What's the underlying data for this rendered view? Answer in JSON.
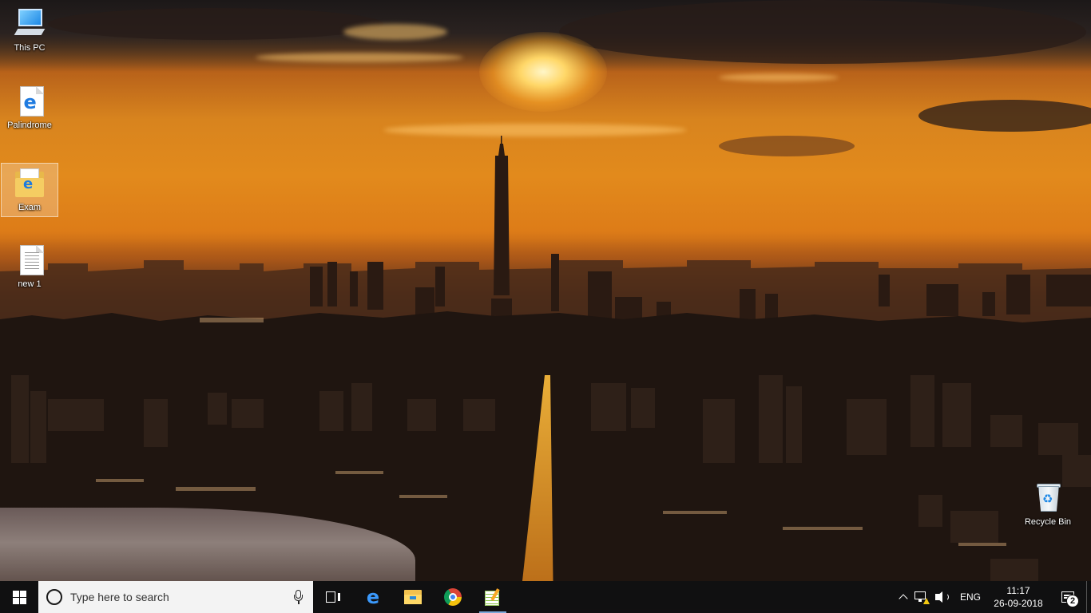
{
  "desktop": {
    "icons": [
      {
        "label": "This PC",
        "icon": "computer-icon"
      },
      {
        "label": "Palindrome",
        "icon": "edge-html-file-icon"
      },
      {
        "label": "Exam",
        "icon": "folder-icon"
      },
      {
        "label": "new 1",
        "icon": "text-file-icon"
      },
      {
        "label": "Recycle Bin",
        "icon": "recycle-bin-icon"
      }
    ],
    "selected_icon": "Exam"
  },
  "taskbar": {
    "search_placeholder": "Type here to search",
    "pinned_apps": [
      "task-view",
      "microsoft-edge",
      "file-explorer",
      "google-chrome",
      "notepad-plus-plus"
    ],
    "tray": {
      "language": "ENG",
      "time": "11:17",
      "date": "26-09-2018",
      "notification_count": "2"
    }
  },
  "colors": {
    "taskbar_bg": "#101012",
    "search_bg": "#f3f3f3",
    "edge_blue": "#3b99fc",
    "sky_orange": "#e28a1c"
  }
}
